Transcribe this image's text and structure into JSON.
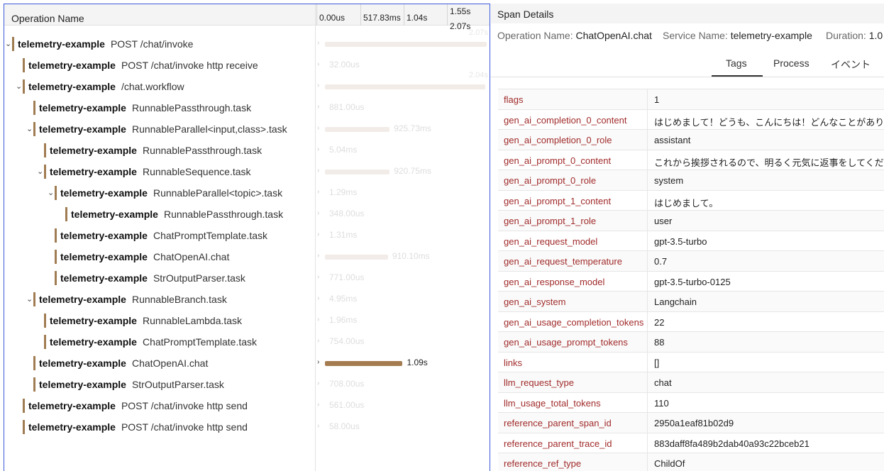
{
  "timeline": {
    "op_header": "Operation Name",
    "ticks": [
      "0.00us",
      "517.83ms",
      "1.04s",
      "1.55s",
      "2.07s"
    ],
    "rows": [
      {
        "service": "telemetry-example",
        "op": "POST /chat/invoke",
        "dur": "2.07s",
        "expandable": true,
        "expanded": true,
        "active": false
      },
      {
        "service": "telemetry-example",
        "op": "POST /chat/invoke http receive",
        "dur": "32.00us",
        "expandable": false,
        "active": false
      },
      {
        "service": "telemetry-example",
        "op": "/chat.workflow",
        "dur": "2.04s",
        "expandable": true,
        "expanded": true,
        "active": false
      },
      {
        "service": "telemetry-example",
        "op": "RunnablePassthrough.task",
        "dur": "881.00us",
        "expandable": false,
        "active": false
      },
      {
        "service": "telemetry-example",
        "op": "RunnableParallel<input,class>.task",
        "dur": "925.73ms",
        "expandable": true,
        "expanded": true,
        "active": false
      },
      {
        "service": "telemetry-example",
        "op": "RunnablePassthrough.task",
        "dur": "5.04ms",
        "expandable": false,
        "active": false
      },
      {
        "service": "telemetry-example",
        "op": "RunnableSequence.task",
        "dur": "920.75ms",
        "expandable": true,
        "expanded": true,
        "active": false
      },
      {
        "service": "telemetry-example",
        "op": "RunnableParallel<topic>.task",
        "dur": "1.29ms",
        "expandable": true,
        "expanded": true,
        "active": false
      },
      {
        "service": "telemetry-example",
        "op": "RunnablePassthrough.task",
        "dur": "348.00us",
        "expandable": false,
        "active": false
      },
      {
        "service": "telemetry-example",
        "op": "ChatPromptTemplate.task",
        "dur": "1.31ms",
        "expandable": false,
        "active": false
      },
      {
        "service": "telemetry-example",
        "op": "ChatOpenAI.chat",
        "dur": "910.10ms",
        "expandable": false,
        "active": false
      },
      {
        "service": "telemetry-example",
        "op": "StrOutputParser.task",
        "dur": "771.00us",
        "expandable": false,
        "active": false
      },
      {
        "service": "telemetry-example",
        "op": "RunnableBranch.task",
        "dur": "4.95ms",
        "expandable": true,
        "expanded": true,
        "active": false
      },
      {
        "service": "telemetry-example",
        "op": "RunnableLambda.task",
        "dur": "1.96ms",
        "expandable": false,
        "active": false
      },
      {
        "service": "telemetry-example",
        "op": "ChatPromptTemplate.task",
        "dur": "754.00us",
        "expandable": false,
        "active": false
      },
      {
        "service": "telemetry-example",
        "op": "ChatOpenAI.chat",
        "dur": "1.09s",
        "expandable": false,
        "active": true
      },
      {
        "service": "telemetry-example",
        "op": "StrOutputParser.task",
        "dur": "708.00us",
        "expandable": false,
        "active": false
      },
      {
        "service": "telemetry-example",
        "op": "POST /chat/invoke http send",
        "dur": "561.00us",
        "expandable": false,
        "active": false
      },
      {
        "service": "telemetry-example",
        "op": "POST /chat/invoke http send",
        "dur": "58.00us",
        "expandable": false,
        "active": false
      }
    ]
  },
  "details": {
    "title": "Span Details",
    "operation_label": "Operation Name:",
    "operation_value": "ChatOpenAI.chat",
    "service_label": "Service Name:",
    "service_value": "telemetry-example",
    "duration_label": "Duration:",
    "duration_value": "1.0",
    "tabs": [
      "Tags",
      "Process",
      "イベント"
    ],
    "tags": [
      {
        "key": "flags",
        "value": "1"
      },
      {
        "key": "gen_ai_completion_0_content",
        "value": "はじめまして！どうも、こんにちは！どんなことがあり"
      },
      {
        "key": "gen_ai_completion_0_role",
        "value": "assistant"
      },
      {
        "key": "gen_ai_prompt_0_content",
        "value": "これから挨拶されるので、明るく元気に返事をしてくだ"
      },
      {
        "key": "gen_ai_prompt_0_role",
        "value": "system"
      },
      {
        "key": "gen_ai_prompt_1_content",
        "value": "はじめまして。"
      },
      {
        "key": "gen_ai_prompt_1_role",
        "value": "user"
      },
      {
        "key": "gen_ai_request_model",
        "value": "gpt-3.5-turbo"
      },
      {
        "key": "gen_ai_request_temperature",
        "value": "0.7"
      },
      {
        "key": "gen_ai_response_model",
        "value": "gpt-3.5-turbo-0125"
      },
      {
        "key": "gen_ai_system",
        "value": "Langchain"
      },
      {
        "key": "gen_ai_usage_completion_tokens",
        "value": "22"
      },
      {
        "key": "gen_ai_usage_prompt_tokens",
        "value": "88"
      },
      {
        "key": "links",
        "value": "[]"
      },
      {
        "key": "llm_request_type",
        "value": "chat"
      },
      {
        "key": "llm_usage_total_tokens",
        "value": "110"
      },
      {
        "key": "reference_parent_span_id",
        "value": "2950a1eaf81b02d9"
      },
      {
        "key": "reference_parent_trace_id",
        "value": "883daff8fa489b2dab40a93c22bceb21"
      },
      {
        "key": "reference_ref_type",
        "value": "ChildOf"
      }
    ]
  },
  "colors": {
    "service_accent": "#a07c52",
    "active_bar": "#a57c50",
    "tag_key": "#a12b2b",
    "panel_border": "#3b5bdb"
  }
}
